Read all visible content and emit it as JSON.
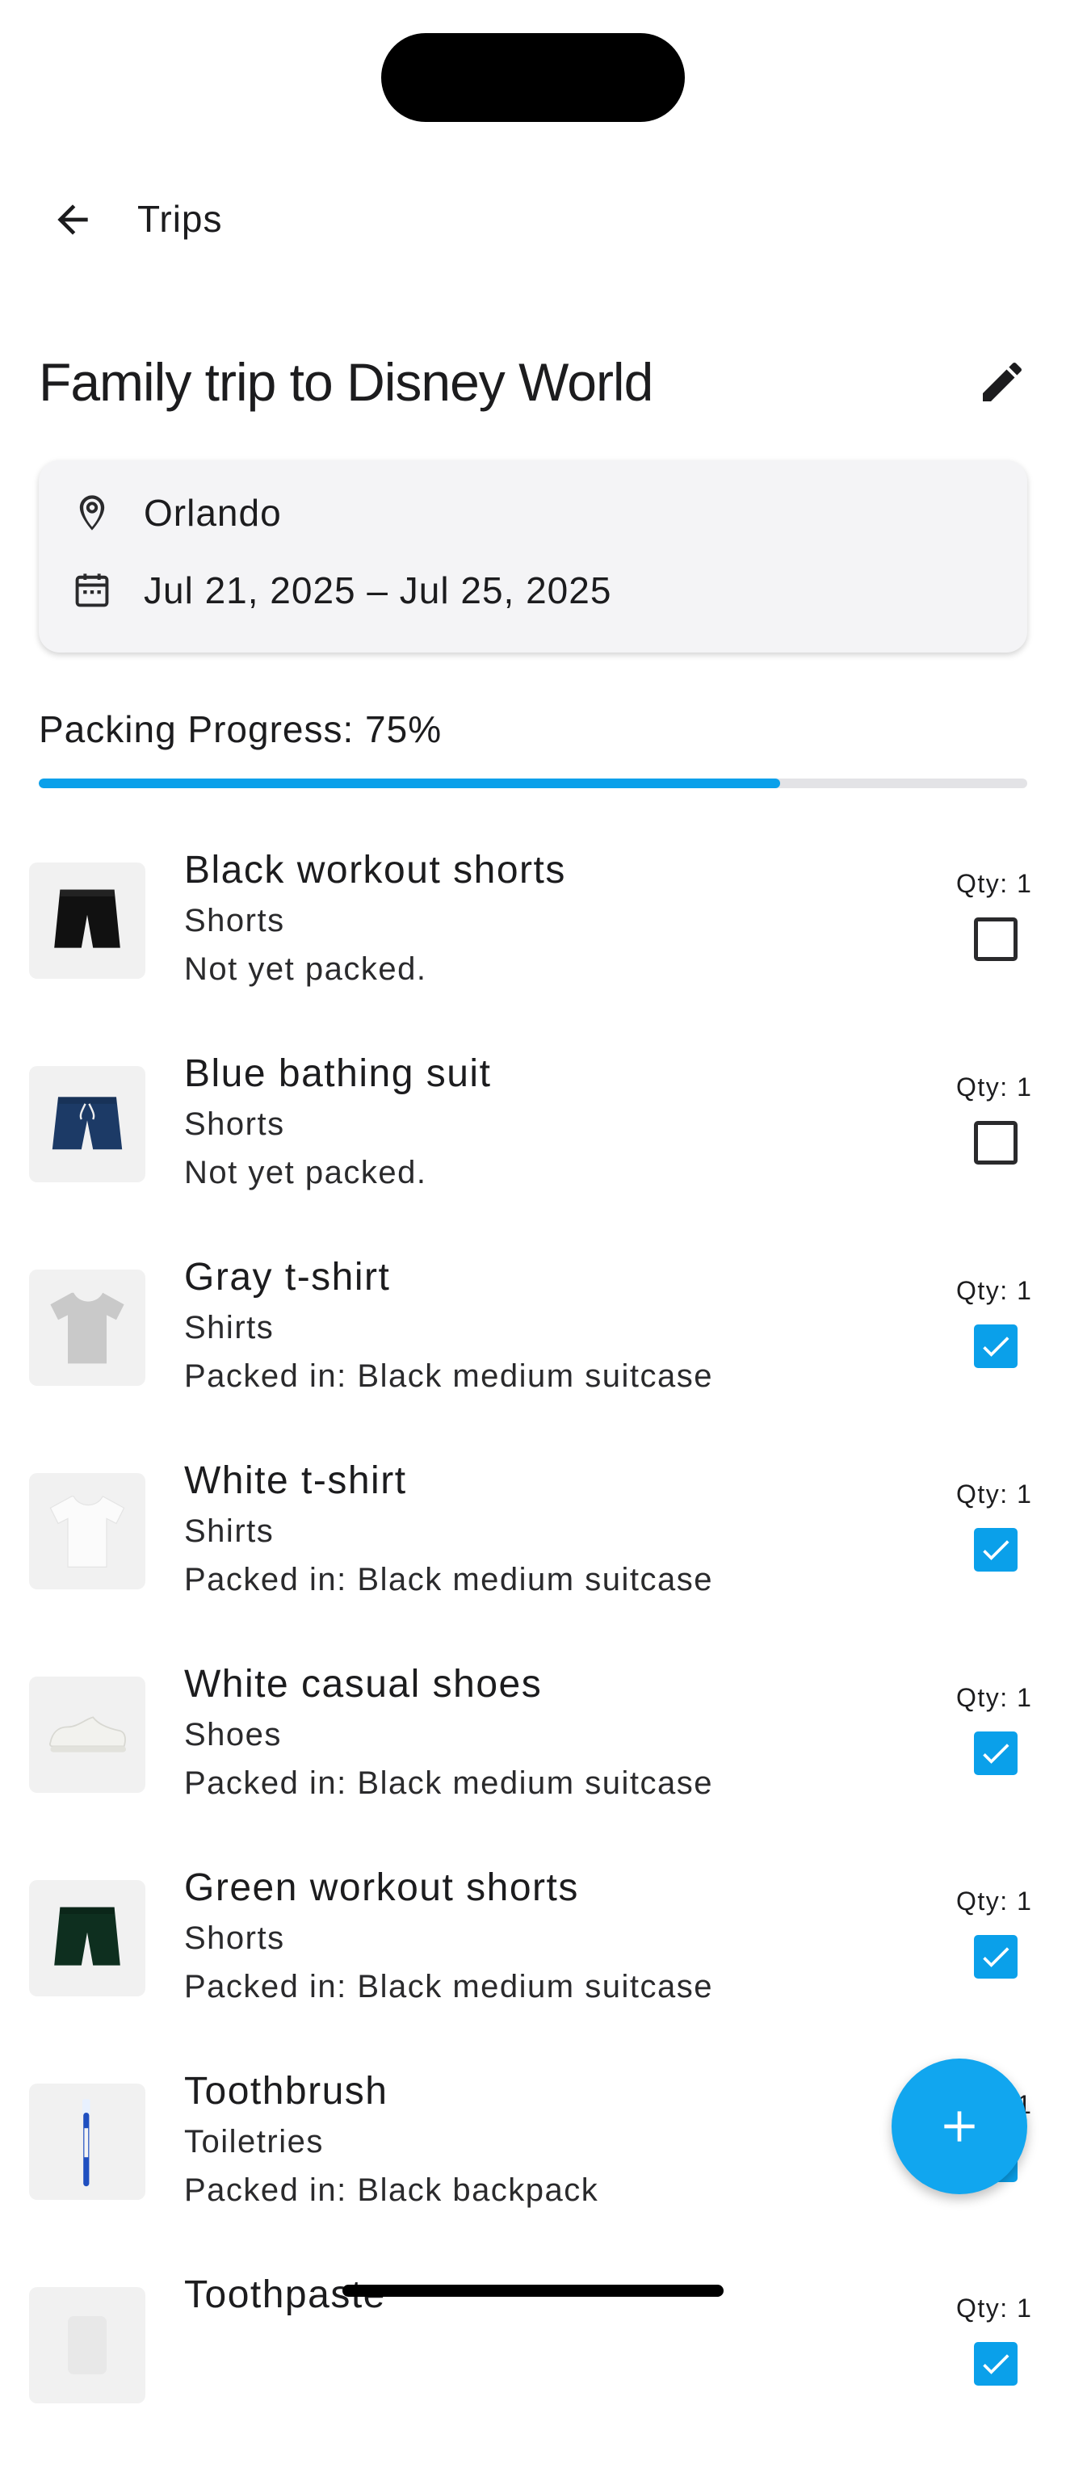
{
  "header": {
    "back_label": "Trips"
  },
  "trip": {
    "title": "Family trip to Disney World",
    "location": "Orlando",
    "dates": "Jul 21, 2025 – Jul 25, 2025"
  },
  "progress": {
    "label": "Packing Progress: 75%",
    "value": 0.75,
    "color": "#0aa0ea"
  },
  "items": [
    {
      "name": "Black workout shorts",
      "category": "Shorts",
      "status": "Not yet packed.",
      "qty": "Qty: 1",
      "packed": false,
      "thumb": "black-shorts-icon"
    },
    {
      "name": "Blue bathing suit",
      "category": "Shorts",
      "status": "Not yet packed.",
      "qty": "Qty: 1",
      "packed": false,
      "thumb": "blue-swim-shorts-icon"
    },
    {
      "name": "Gray t-shirt",
      "category": "Shirts",
      "status": "Packed in: Black medium suitcase",
      "qty": "Qty: 1",
      "packed": true,
      "thumb": "gray-tshirt-icon"
    },
    {
      "name": "White t-shirt",
      "category": "Shirts",
      "status": "Packed in: Black medium suitcase",
      "qty": "Qty: 1",
      "packed": true,
      "thumb": "white-tshirt-icon"
    },
    {
      "name": "White casual shoes",
      "category": "Shoes",
      "status": "Packed in: Black medium suitcase",
      "qty": "Qty: 1",
      "packed": true,
      "thumb": "white-shoe-icon"
    },
    {
      "name": "Green workout shorts",
      "category": "Shorts",
      "status": "Packed in: Black medium suitcase",
      "qty": "Qty: 1",
      "packed": true,
      "thumb": "green-shorts-icon"
    },
    {
      "name": "Toothbrush",
      "category": "Toiletries",
      "status": "Packed in: Black backpack",
      "qty": "Qty: 1",
      "packed": true,
      "thumb": "toothbrush-icon"
    },
    {
      "name": "Toothpaste",
      "category": "",
      "status": "",
      "qty": "Qty: 1",
      "packed": true,
      "thumb": "toothpaste-icon"
    }
  ],
  "colors": {
    "accent": "#0aa0ea",
    "fab": "#11a6ef"
  }
}
